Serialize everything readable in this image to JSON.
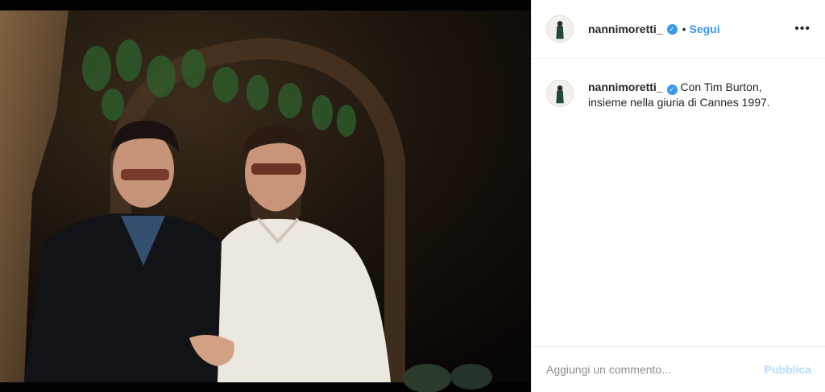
{
  "post": {
    "author": "nannimoretti_",
    "verified": true,
    "follow_label": "Segui",
    "separator": "•",
    "more_icon": "more-horizontal-icon",
    "caption": "Con Tim Burton, insieme nella giuria di Cannes 1997."
  },
  "comment": {
    "placeholder": "Aggiungi un commento...",
    "publish_label": "Pubblica"
  },
  "colors": {
    "link_blue": "#3897f0",
    "publish_disabled": "#b3dbff",
    "border": "#efefef"
  }
}
